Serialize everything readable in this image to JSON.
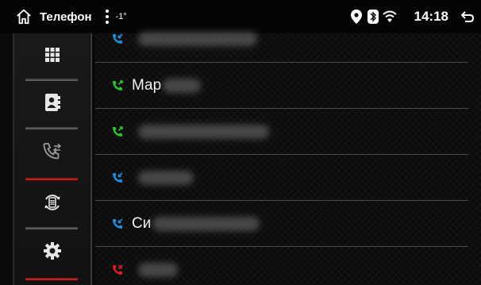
{
  "statusbar": {
    "title": "Телефон",
    "temperature": "-1°",
    "time": "14:18",
    "icons": [
      "home-icon",
      "more-vert-icon",
      "location-icon",
      "bluetooth-icon",
      "wifi-icon",
      "back-icon"
    ]
  },
  "sidebar": {
    "items": [
      {
        "icon": "keypad-icon"
      },
      {
        "icon": "contacts-icon"
      },
      {
        "icon": "call-log-icon",
        "active": true
      },
      {
        "icon": "phone-sync-icon"
      },
      {
        "icon": "settings-icon"
      }
    ]
  },
  "calls": [
    {
      "type": "incoming",
      "color": "#1e90e0",
      "name": ""
    },
    {
      "type": "outgoing",
      "color": "#28c828",
      "name": "Мар"
    },
    {
      "type": "outgoing",
      "color": "#28c828",
      "name": ""
    },
    {
      "type": "incoming",
      "color": "#1e90e0",
      "name": ""
    },
    {
      "type": "incoming",
      "color": "#1e90e0",
      "name": "Си"
    },
    {
      "type": "missed",
      "color": "#e02020",
      "name": ""
    }
  ],
  "colors": {
    "accent_red": "#e02020",
    "incoming": "#1e90e0",
    "outgoing": "#28c828",
    "missed": "#e02020"
  }
}
